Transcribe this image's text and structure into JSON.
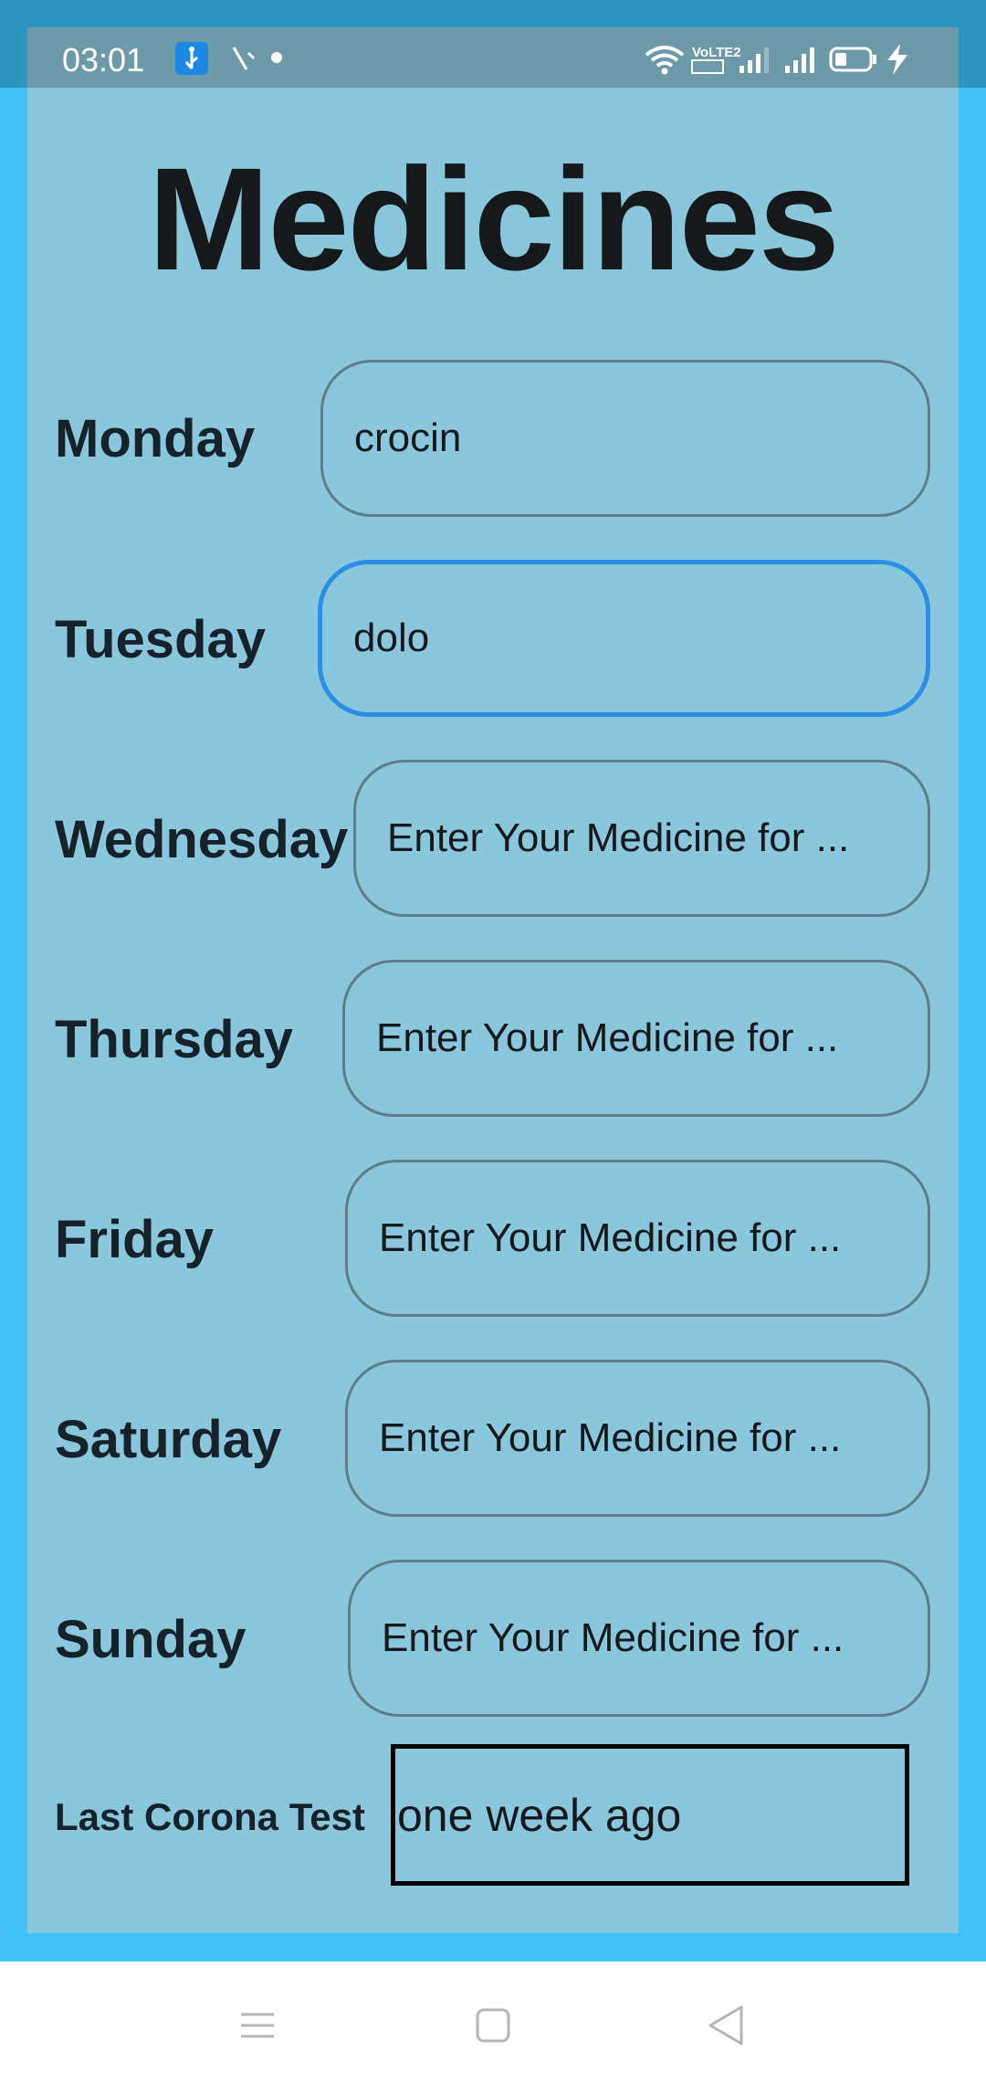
{
  "status_bar": {
    "time": "03:01",
    "icons": [
      "usb-icon",
      "missed-call-icon",
      "notification-dot-icon",
      "wifi-icon",
      "volte-icon",
      "signal-icon",
      "signal-icon",
      "battery-icon",
      "charging-icon"
    ],
    "volte_label": "VoLTE2"
  },
  "page": {
    "title": "Medicines"
  },
  "days": [
    {
      "label": "Monday",
      "value": "crocin",
      "placeholder": "Enter Your Medicine for ..."
    },
    {
      "label": "Tuesday",
      "value": "dolo",
      "placeholder": "Enter Your Medicine for ..."
    },
    {
      "label": "Wednesday",
      "value": "",
      "placeholder": "Enter Your Medicine for ..."
    },
    {
      "label": "Thursday",
      "value": "",
      "placeholder": "Enter Your Medicine for ..."
    },
    {
      "label": "Friday",
      "value": "",
      "placeholder": "Enter Your Medicine for ..."
    },
    {
      "label": "Saturday",
      "value": "",
      "placeholder": "Enter Your Medicine for ..."
    },
    {
      "label": "Sunday",
      "value": "",
      "placeholder": "Enter Your Medicine for ..."
    }
  ],
  "corona": {
    "label": "Last Corona Test",
    "value": "one week ago"
  },
  "nav_bar": {
    "icons": [
      "menu-icon",
      "home-icon",
      "back-icon"
    ]
  },
  "colors": {
    "app_background": "#41c1f5",
    "panel": "#8ac6dc",
    "focus_border": "#2b8fe6",
    "text": "#15191c"
  }
}
